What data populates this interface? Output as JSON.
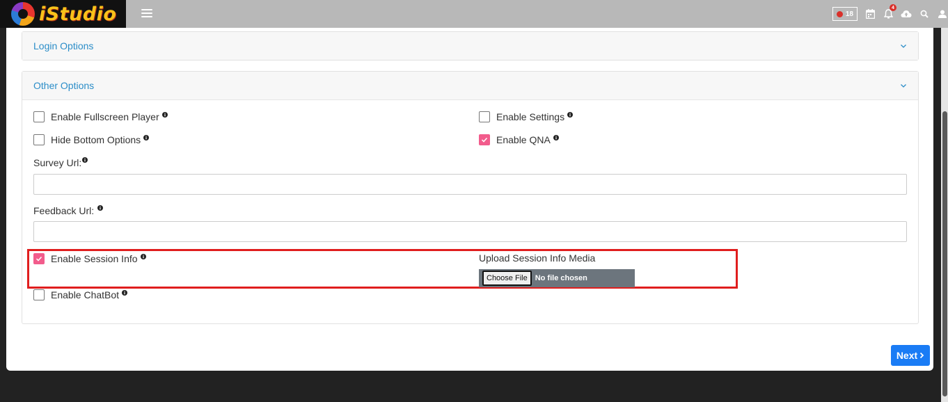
{
  "header": {
    "logo_text": "iStudio",
    "recording_count": "18",
    "notification_count": "4"
  },
  "panels": {
    "login": {
      "title": "Login Options"
    },
    "other": {
      "title": "Other Options"
    }
  },
  "options": {
    "fullscreen": {
      "label": "Enable Fullscreen Player",
      "checked": false
    },
    "settings": {
      "label": "Enable Settings",
      "checked": false
    },
    "hide_bottom": {
      "label": "Hide Bottom Options",
      "checked": false
    },
    "qna": {
      "label": "Enable QNA",
      "checked": true
    },
    "session_info": {
      "label": "Enable Session Info",
      "checked": true
    },
    "chatbot": {
      "label": "Enable ChatBot",
      "checked": false
    }
  },
  "fields": {
    "survey": {
      "label": "Survey Url:",
      "value": ""
    },
    "feedback": {
      "label": "Feedback Url:",
      "value": ""
    }
  },
  "upload": {
    "label": "Upload Session Info Media",
    "button": "Choose File",
    "status": "No file chosen"
  },
  "footer": {
    "next_label": "Next"
  },
  "colors": {
    "accent": "#2b8dc8",
    "checkbox_checked": "#f25c8c",
    "highlight": "#e01e1e",
    "primary_button": "#1a7cf5"
  }
}
